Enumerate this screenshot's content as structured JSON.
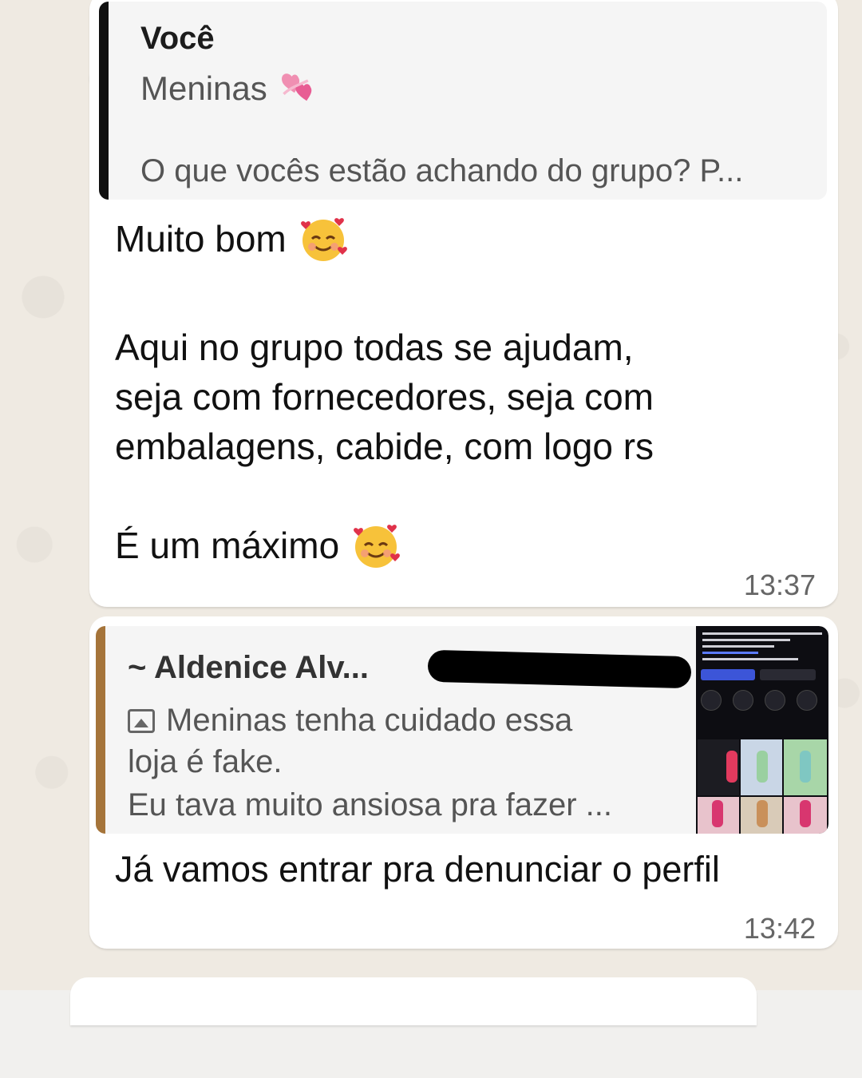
{
  "colors": {
    "chat_background": "#efeae2",
    "bubble": "#ffffff",
    "quote_background": "#f5f5f5",
    "quote_bar_self": "#111111",
    "quote_bar_other": "#a5743a"
  },
  "messages": [
    {
      "quote": {
        "author": "Você",
        "subtitle": "Meninas",
        "subtitle_icon": "revolving-hearts-emoji",
        "snippet": "O que vocês estão achando do grupo? P..."
      },
      "body": {
        "line1": "Muito bom",
        "line1_icon": "smiling-face-with-hearts-emoji",
        "paragraph": [
          "Aqui no grupo todas se ajudam,",
          "seja com fornecedores, seja com",
          "embalagens, cabide, com logo rs"
        ],
        "line3": "É um máximo",
        "line3_icon": "smiling-face-with-hearts-emoji"
      },
      "time": "13:37"
    },
    {
      "quote": {
        "author": "~ Aldenice Alv...",
        "author_phone_redacted": true,
        "media_icon": "image-icon",
        "lines": [
          "Meninas tenha cuidado essa",
          "loja é fake.",
          "Eu tava muito ansiosa pra fazer ..."
        ],
        "thumbnail": "screenshot-thumbnail"
      },
      "body": {
        "text": "Já vamos entrar pra denunciar o perfil"
      },
      "time": "13:42"
    }
  ]
}
